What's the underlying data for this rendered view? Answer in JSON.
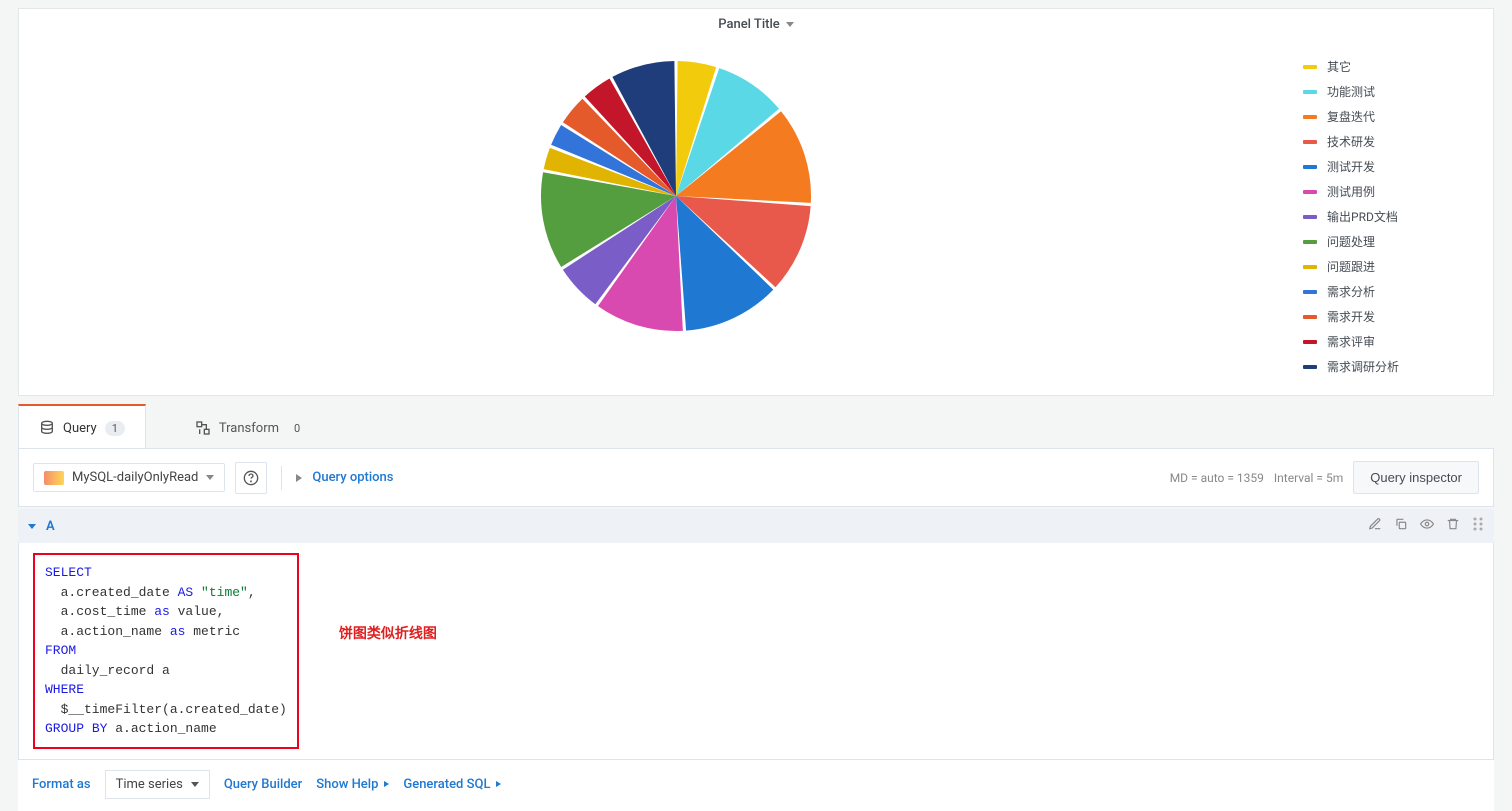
{
  "panel": {
    "title": "Panel Title"
  },
  "chart_data": {
    "type": "pie",
    "title": "Panel Title",
    "series": [
      {
        "name": "其它",
        "value": 5,
        "color": "#f2cc0c"
      },
      {
        "name": "功能测试",
        "value": 9,
        "color": "#5ad8e6"
      },
      {
        "name": "复盘迭代",
        "value": 12,
        "color": "#f47b20"
      },
      {
        "name": "技术研发",
        "value": 11,
        "color": "#e8594b"
      },
      {
        "name": "测试开发",
        "value": 12,
        "color": "#1f78d1"
      },
      {
        "name": "测试用例",
        "value": 11,
        "color": "#d84ab0"
      },
      {
        "name": "输出PRD文档",
        "value": 6,
        "color": "#7a5dc7"
      },
      {
        "name": "问题处理",
        "value": 12,
        "color": "#549e3f"
      },
      {
        "name": "问题跟进",
        "value": 3,
        "color": "#e0b400"
      },
      {
        "name": "需求分析",
        "value": 3,
        "color": "#3274d9"
      },
      {
        "name": "需求开发",
        "value": 4,
        "color": "#e55a2b"
      },
      {
        "name": "需求评审",
        "value": 4,
        "color": "#c4162a"
      },
      {
        "name": "需求调研分析",
        "value": 8,
        "color": "#1f3d7a"
      }
    ]
  },
  "tabs": {
    "query_label": "Query",
    "query_count": "1",
    "transform_label": "Transform",
    "transform_count": "0"
  },
  "toolbar": {
    "datasource": "MySQL-dailyOnlyRead",
    "query_options": "Query options",
    "md_text": "MD = auto = 1359",
    "interval_text": "Interval = 5m",
    "inspector": "Query inspector"
  },
  "query": {
    "letter": "A",
    "sql_parts": {
      "l1": "SELECT",
      "l2a": "  a.created_date ",
      "l2b": "AS",
      "l2c": " \"time\"",
      "l2d": ",",
      "l3a": "  a.cost_time ",
      "l3b": "as",
      "l3c": " value,",
      "l4a": "  a.action_name ",
      "l4b": "as",
      "l4c": " metric",
      "l5": "FROM",
      "l6": "  daily_record a",
      "l7": "WHERE",
      "l8": "  $__timeFilter(a.created_date)",
      "l9a": "GROUP ",
      "l9b": "BY",
      "l9c": " a.action_name"
    },
    "annotation": "饼图类似折线图"
  },
  "bottom": {
    "format_as": "Format as",
    "format_value": "Time series",
    "query_builder": "Query Builder",
    "show_help": "Show Help",
    "generated_sql": "Generated SQL"
  }
}
